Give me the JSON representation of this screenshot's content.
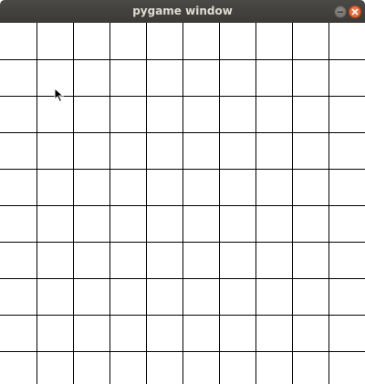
{
  "window": {
    "title": "pygame window"
  },
  "icons": {
    "minimize": "minimize-icon",
    "close": "close-icon",
    "cursor": "mouse-pointer-icon"
  },
  "colors": {
    "titlebar": "#3c3b37",
    "close_button": "#e95420",
    "grid_line": "#000000",
    "canvas_background": "#ffffff"
  },
  "grid": {
    "columns": 10,
    "rows": 10
  }
}
